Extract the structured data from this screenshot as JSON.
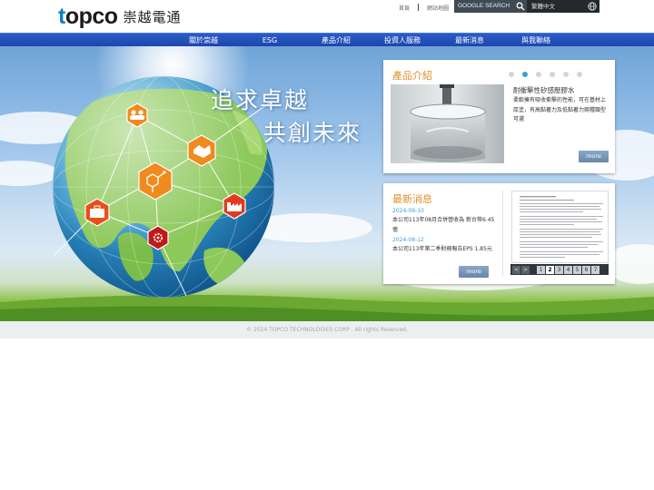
{
  "brand": {
    "logo_latin": "topco",
    "logo_cjk": "崇越電通"
  },
  "toplinks": [
    "首頁",
    "網站地圖"
  ],
  "search": {
    "placeholder": "GOOGLE SEARCH",
    "icon": "search-icon"
  },
  "language": {
    "current": "繁體中文",
    "icon": "globe-icon"
  },
  "nav": [
    "關於崇越",
    "ESG",
    "產品介紹",
    "投資人服務",
    "最新消息",
    "與我聯絡"
  ],
  "hero": {
    "slogan_line1": "追求卓越",
    "slogan_line2": "共創未來"
  },
  "products": {
    "title": "產品介紹",
    "slides": 6,
    "active_slide": 2,
    "item_name": "耐衝擊性矽感壓膠水",
    "item_desc": "柔軟擁有吸收衝擊的性能，可在基材上厚塗，有高黏著力及低黏著力兩種類型可選",
    "more_label": "more"
  },
  "news": {
    "title": "最新消息",
    "items": [
      {
        "date": "2024-09-10",
        "title": "本公司113年08月合併營收為 新台幣6.45億"
      },
      {
        "date": "2024-08-12",
        "title": "本公司113年第二季財務報告EPS 1.85元"
      }
    ],
    "more_label": "more",
    "pager": {
      "prev": "<",
      "next": ">",
      "pages": [
        "1",
        "2",
        "3",
        "4",
        "5",
        "6",
        "7"
      ],
      "active": "2"
    }
  },
  "footer": {
    "copyright": "© 2024 TOPCO TECHNOLOGIES CORP . All rights Reserved."
  },
  "colors": {
    "nav_blue": "#1d46ad",
    "accent_orange": "#e0902a",
    "date_blue": "#3e9ed0",
    "hexagon": "#f08a1c",
    "hexagon_red": "#e23a1e"
  }
}
